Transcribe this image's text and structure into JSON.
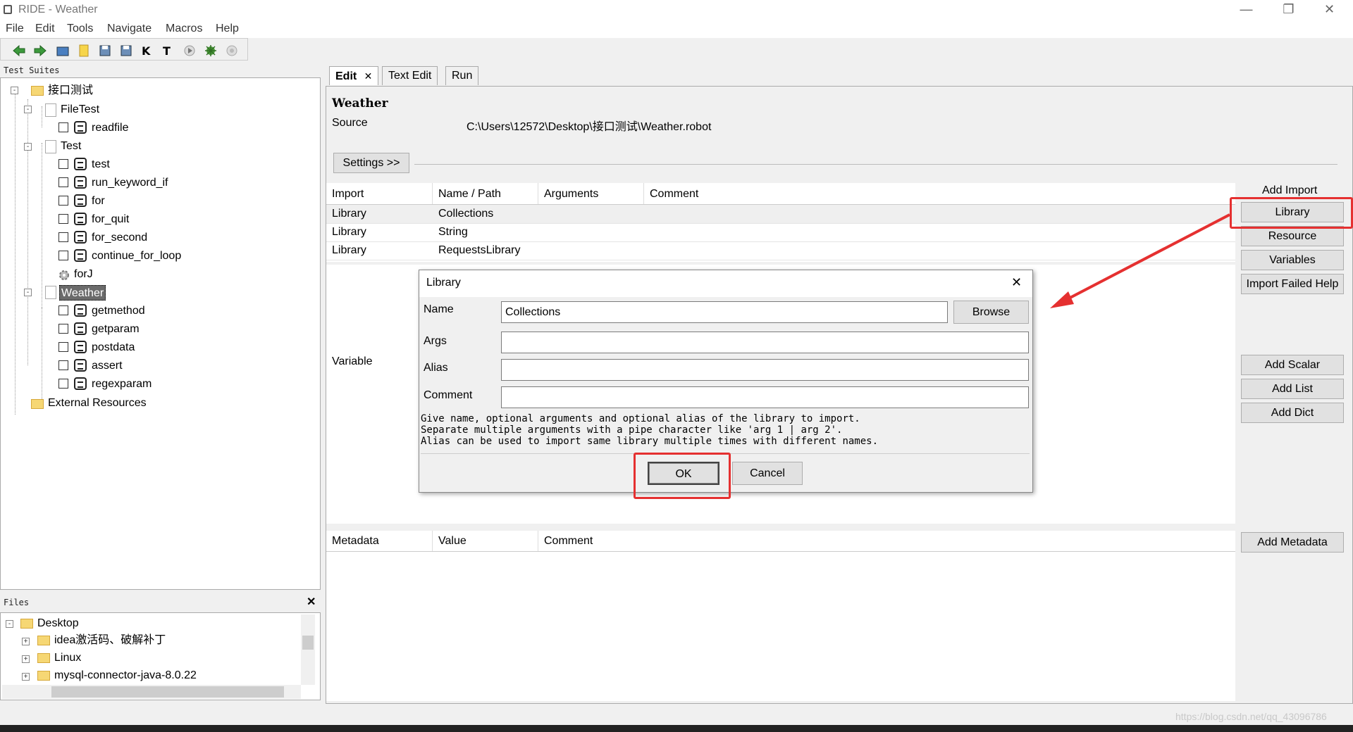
{
  "window": {
    "title": "RIDE - Weather"
  },
  "menu": [
    "File",
    "Edit",
    "Tools",
    "Navigate",
    "Macros",
    "Help"
  ],
  "toolbar_icons": [
    "back-arrow-icon",
    "forward-arrow-icon",
    "open-folder-icon",
    "new-file-icon",
    "save-icon",
    "save-all-icon",
    "keyword-search-icon",
    "test-search-icon",
    "play-icon",
    "bug-icon",
    "stop-icon"
  ],
  "tree": {
    "title": "Test Suites",
    "root": "接口测试",
    "suites": [
      {
        "name": "FileTest",
        "tests": [
          "readfile"
        ]
      },
      {
        "name": "Test",
        "tests": [
          "test",
          "run_keyword_if",
          "for",
          "for_quit",
          "for_second",
          "continue_for_loop"
        ],
        "keyword": "forJ"
      },
      {
        "name": "Weather",
        "tests": [
          "getmethod",
          "getparam",
          "postdata",
          "assert",
          "regexparam"
        ]
      }
    ],
    "external": "External Resources"
  },
  "files": {
    "title": "Files",
    "items": [
      "Desktop",
      "idea激活码、破解补丁",
      "Linux",
      "mysql-connector-java-8.0.22"
    ]
  },
  "tabs": [
    "Edit",
    "Text Edit",
    "Run"
  ],
  "editor": {
    "suite_name": "Weather",
    "source_label": "Source",
    "source_path": "C:\\Users\\12572\\Desktop\\接口测试\\Weather.robot",
    "settings_button": "Settings >>",
    "import_headers": [
      "Import",
      "Name / Path",
      "Arguments",
      "Comment"
    ],
    "imports": [
      {
        "type": "Library",
        "name": "Collections"
      },
      {
        "type": "Library",
        "name": "String"
      },
      {
        "type": "Library",
        "name": "RequestsLibrary"
      }
    ],
    "add_import_label": "Add Import",
    "import_buttons": [
      "Library",
      "Resource",
      "Variables",
      "Import Failed Help"
    ],
    "variable_label": "Variable",
    "variable_buttons": [
      "Add Scalar",
      "Add List",
      "Add Dict"
    ],
    "metadata_headers": [
      "Metadata",
      "Value",
      "Comment"
    ],
    "metadata_button": "Add Metadata"
  },
  "dialog": {
    "title": "Library",
    "close_glyph": "✕",
    "fields": [
      {
        "label": "Name",
        "value": "Collections"
      },
      {
        "label": "Args",
        "value": ""
      },
      {
        "label": "Alias",
        "value": ""
      },
      {
        "label": "Comment",
        "value": ""
      }
    ],
    "browse_button": "Browse",
    "help_lines": [
      "Give name, optional arguments and optional alias of the library to import.",
      "Separate multiple arguments with a pipe character like 'arg 1 | arg 2'.",
      "Alias can be used to import same library multiple times with different names."
    ],
    "ok_button": "OK",
    "cancel_button": "Cancel"
  },
  "watermark": "https://blog.csdn.net/qq_43096786",
  "colors": {
    "highlight_red": "#e53030",
    "selected_node_bg": "#6b6b6b"
  }
}
